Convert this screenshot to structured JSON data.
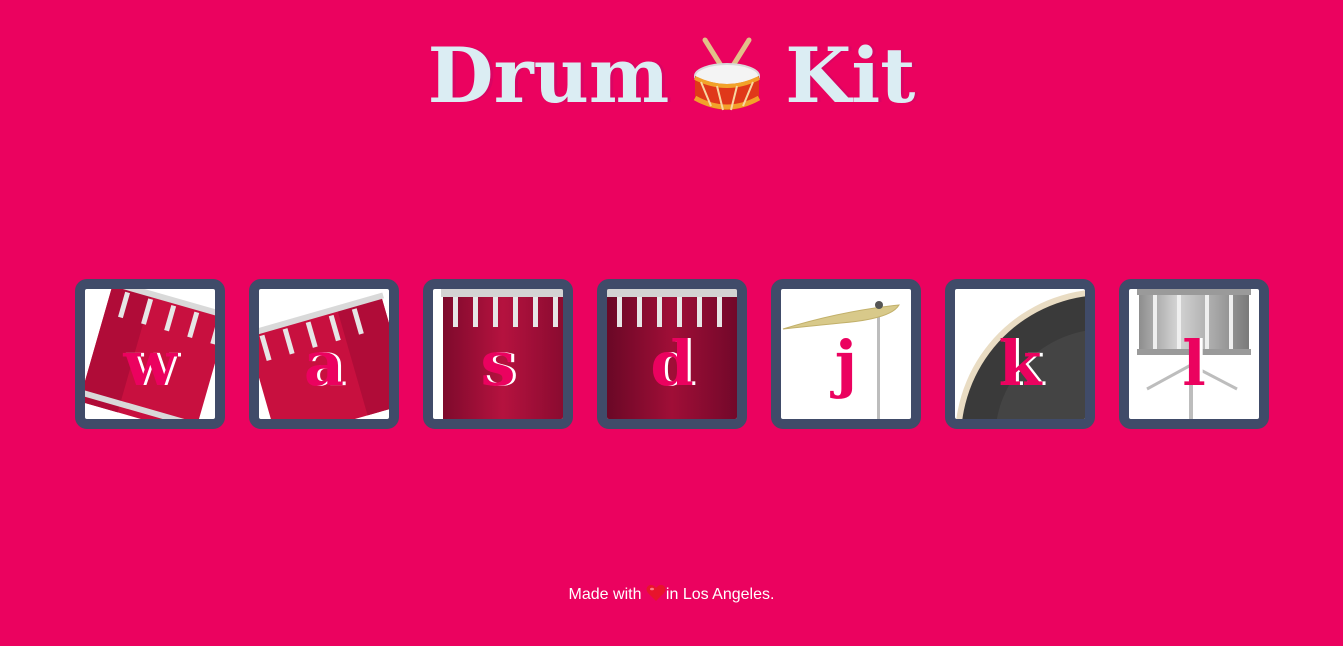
{
  "header": {
    "title_left": "Drum",
    "title_right": "Kit",
    "icon": "drum-icon"
  },
  "drums": [
    {
      "key": "w",
      "kind": "tom-tilted",
      "color": "#C8103F"
    },
    {
      "key": "a",
      "kind": "tom-tilted",
      "color": "#C8103F"
    },
    {
      "key": "s",
      "kind": "floor-tom",
      "color": "#A80D3A"
    },
    {
      "key": "d",
      "kind": "floor-tom-dark",
      "color": "#8C0A32"
    },
    {
      "key": "j",
      "kind": "cymbal",
      "color": "#D8C98A"
    },
    {
      "key": "k",
      "kind": "bass-drum",
      "color": "#3A3A3A"
    },
    {
      "key": "l",
      "kind": "snare",
      "color": "#B5B5B5"
    }
  ],
  "footer": {
    "before": "Made with",
    "after": "in Los Angeles.",
    "icon": "heart-icon"
  },
  "colors": {
    "background": "#EB025F",
    "pad_border": "#404B69",
    "title": "#DBEDF3"
  }
}
